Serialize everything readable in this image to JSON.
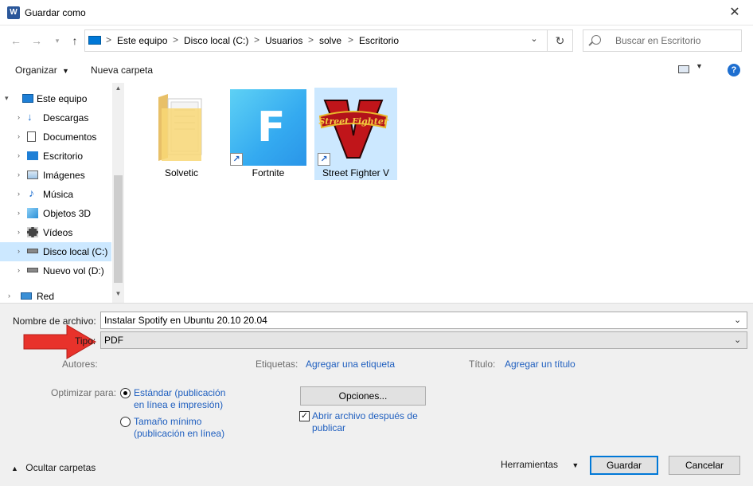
{
  "window": {
    "title": "Guardar como",
    "app_icon_letter": "W"
  },
  "address_bar": {
    "breadcrumbs": [
      "Este equipo",
      "Disco local (C:)",
      "Usuarios",
      "solve",
      "Escritorio"
    ],
    "separator": ">"
  },
  "search": {
    "placeholder": "Buscar en Escritorio"
  },
  "toolbar": {
    "organize_label": "Organizar",
    "new_folder_label": "Nueva carpeta"
  },
  "sidebar": {
    "items": [
      {
        "label": "Este equipo",
        "icon": "computer-icon"
      },
      {
        "label": "Descargas",
        "icon": "downloads-icon"
      },
      {
        "label": "Documentos",
        "icon": "documents-icon"
      },
      {
        "label": "Escritorio",
        "icon": "desktop-icon"
      },
      {
        "label": "Imágenes",
        "icon": "pictures-icon"
      },
      {
        "label": "Música",
        "icon": "music-icon"
      },
      {
        "label": "Objetos 3D",
        "icon": "3d-objects-icon"
      },
      {
        "label": "Vídeos",
        "icon": "videos-icon"
      },
      {
        "label": "Disco local (C:)",
        "icon": "drive-icon",
        "selected": true
      },
      {
        "label": "Nuevo vol (D:)",
        "icon": "drive-icon"
      },
      {
        "label": "Red",
        "icon": "network-icon"
      }
    ]
  },
  "files": [
    {
      "name": "Solvetic",
      "type": "folder"
    },
    {
      "name": "Fortnite",
      "type": "shortcut",
      "glyph": "F"
    },
    {
      "name": "Street Fighter V",
      "type": "shortcut",
      "selected": true,
      "glyph": "V"
    }
  ],
  "form": {
    "filename_label": "Nombre de archivo:",
    "filename_value": "Instalar Spotify en Ubuntu 20.10  20.04",
    "type_label": "Tipo:",
    "type_value": "PDF",
    "authors_label": "Autores:",
    "tags_label": "Etiquetas:",
    "tags_link": "Agregar una etiqueta",
    "title_label": "Título:",
    "title_link": "Agregar un título",
    "optimize_label": "Optimizar para:",
    "optimize_standard_line1": "Estándar (publicación",
    "optimize_standard_line2": "en línea e impresión)",
    "optimize_min_line1": "Tamaño mínimo",
    "optimize_min_line2": "(publicación en línea)",
    "options_button": "Opciones...",
    "open_after_line1": "Abrir archivo después de",
    "open_after_line2": "publicar",
    "open_after_checked": true
  },
  "footer": {
    "hide_folders": "Ocultar carpetas",
    "tools": "Herramientas",
    "save": "Guardar",
    "cancel": "Cancelar"
  },
  "colors": {
    "accent": "#0078d7",
    "link": "#1f5fbf",
    "selection": "#cce8ff",
    "arrow": "#e8322b"
  }
}
